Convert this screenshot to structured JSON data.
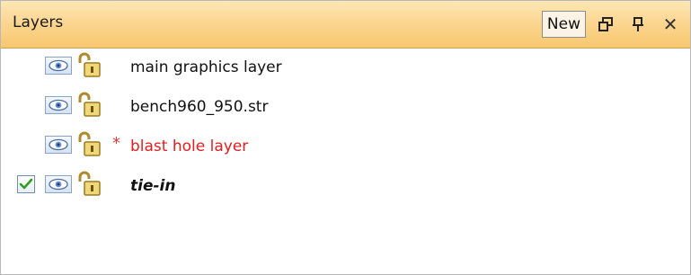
{
  "panel": {
    "title": "Layers",
    "new_button": "New",
    "controls": [
      "float-window-icon",
      "pin-icon",
      "close-icon"
    ]
  },
  "layers": [
    {
      "name": "main graphics layer",
      "visible": true,
      "locked": false,
      "modified": false,
      "active": false,
      "color": "#111111"
    },
    {
      "name": "bench960_950.str",
      "visible": true,
      "locked": false,
      "modified": false,
      "active": false,
      "color": "#111111"
    },
    {
      "name": "blast hole layer",
      "visible": true,
      "locked": false,
      "modified": true,
      "active": false,
      "color": "#e81c1c",
      "modified_marker": "*"
    },
    {
      "name": "tie-in",
      "visible": true,
      "locked": false,
      "modified": false,
      "active": true,
      "color": "#111111",
      "style": "bold-italic"
    }
  ],
  "colors": {
    "title_bar": "#fbd38b",
    "modified_text": "#e81c1c",
    "check_green": "#2e9e1f"
  }
}
